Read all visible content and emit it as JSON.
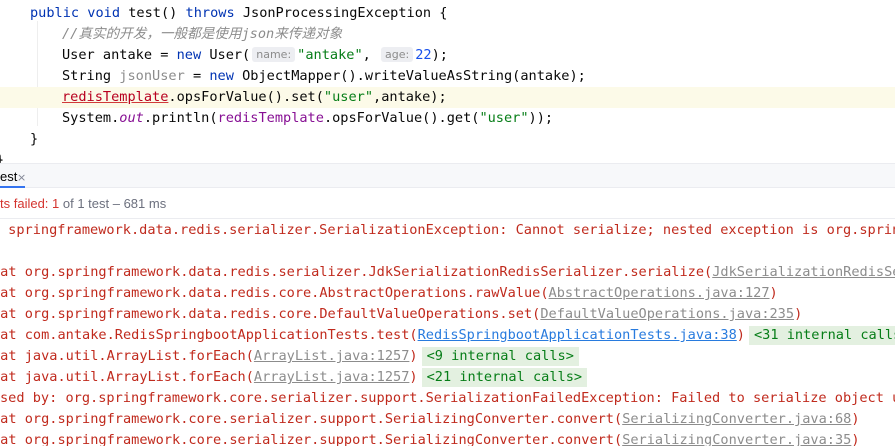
{
  "editor": {
    "line1": {
      "kw_public": "public",
      "kw_void": "void",
      "method": "test() ",
      "kw_throws": "throws",
      "exception": " JsonProcessingException {"
    },
    "line2": {
      "comment": "//真实的开发，一般都是使用json来传递对象"
    },
    "line3": {
      "type": "User antake = ",
      "kw_new": "new",
      "ctor": " User(",
      "hint_name": "name:",
      "str_name": "\"antake\"",
      "comma": ", ",
      "hint_age": "age:",
      "num_age": "22",
      "end": ");"
    },
    "line4": {
      "type": "String ",
      "var": "jsonUser",
      "eq": " = ",
      "kw_new": "new",
      "rest": " ObjectMapper().writeValueAsString(antake);"
    },
    "line5": {
      "field": "redisTemplate",
      "call": ".opsForValue().set(",
      "str": "\"user\"",
      "end": ",antake);"
    },
    "line6": {
      "pre": "System.",
      "out": "out",
      "mid": ".println(",
      "field": "redisTemplate",
      "call": ".opsForValue().get(",
      "str": "\"user\"",
      "end": "));"
    },
    "line7": {
      "brace": "}"
    },
    "line8": {
      "brace": "}"
    }
  },
  "run_panel": {
    "tab_label": "est",
    "tab_close": "×",
    "status_failed": "ts failed: 1",
    "status_detail": " of 1 test – 681 ms"
  },
  "console": {
    "lines": [
      {
        "text": " springframework.data.redis.serializer.SerializationException: Cannot serialize; nested exception is org.springfr"
      },
      {
        "text": ""
      },
      {
        "text": " at org.springframework.data.redis.serializer.JdkSerializationRedisSerializer.serialize(",
        "link": "JdkSerializationRedisSeri",
        "link_style": "gray"
      },
      {
        "text": " at org.springframework.data.redis.core.AbstractOperations.rawValue(",
        "link": "AbstractOperations.java:127",
        "link_style": "gray",
        "after": ")"
      },
      {
        "text": " at org.springframework.data.redis.core.DefaultValueOperations.set(",
        "link": "DefaultValueOperations.java:235",
        "link_style": "gray",
        "after": ")"
      },
      {
        "text": " at com.antake.RedisSpringbootApplicationTests.test(",
        "link": "RedisSpringbootApplicationTests.java:38",
        "link_style": "blue",
        "after": ")",
        "internal": "<31 internal calls>"
      },
      {
        "text": " at java.util.ArrayList.forEach(",
        "link": "ArrayList.java:1257",
        "link_style": "gray",
        "after": ")",
        "internal": "<9 internal calls>"
      },
      {
        "text": " at java.util.ArrayList.forEach(",
        "link": "ArrayList.java:1257",
        "link_style": "gray",
        "after": ")",
        "internal": "<21 internal calls>"
      },
      {
        "text": "sed by: org.springframework.core.serializer.support.SerializationFailedException: Failed to serialize object usir"
      },
      {
        "text": " at org.springframework.core.serializer.support.SerializingConverter.convert(",
        "link": "SerializingConverter.java:68",
        "link_style": "gray",
        "after": ")"
      },
      {
        "text": " at org.springframework.core.serializer.support.SerializingConverter.convert(",
        "link": "SerializingConverter.java:35",
        "link_style": "gray",
        "after": ")"
      }
    ]
  },
  "colors": {
    "keyword": "#0033b3",
    "string": "#067d17",
    "error_text": "#c02a1d",
    "link": "#287bde",
    "accent_tab": "#3574f0"
  }
}
